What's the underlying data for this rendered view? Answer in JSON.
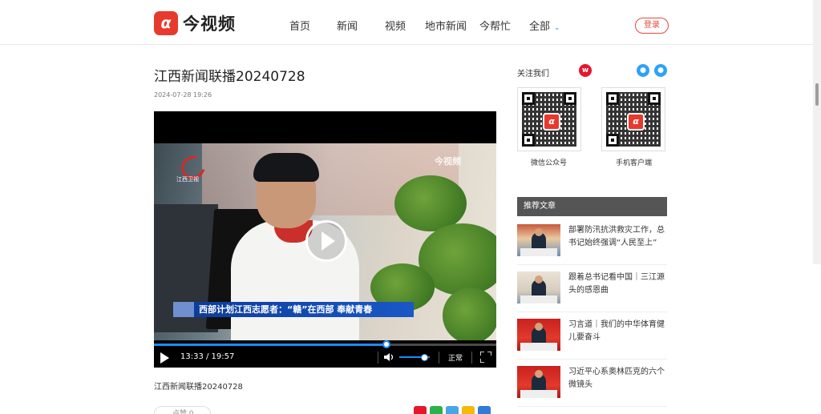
{
  "header": {
    "logo_text": "今视频",
    "logo_mark": "α",
    "nav": [
      "首页",
      "新闻",
      "视频",
      "地市新闻",
      "今帮忙",
      "全部"
    ],
    "nav_more_icon": "chevron-down-icon",
    "login_label": "登录"
  },
  "article": {
    "title": "江西新闻联播20240728",
    "date": "2024-07-28 19:26",
    "description": "江西新闻联播20240728",
    "like_label": "点赞 0"
  },
  "video": {
    "watermark": "今视频",
    "channel_logo_text": "江西卫视",
    "caption": "西部计划江西志愿者：“赣”在西部  奉献青春",
    "current_time": "13:33",
    "duration": "19:57",
    "time_text": "13:33 / 19:57",
    "progress": 0.679,
    "volume": 0.8,
    "speed_label": "正常"
  },
  "sidebar": {
    "follow_label": "关注我们",
    "qr_codes": [
      {
        "caption": "微信公众号"
      },
      {
        "caption": "手机客户端"
      }
    ],
    "recommend_title": "推荐文章",
    "recommended": [
      {
        "title": "部署防汛抗洪救灾工作，总书记始终强调“人民至上”"
      },
      {
        "title": "跟着总书记看中国｜三江源头的感恩曲"
      },
      {
        "title": "习言道｜我们的中华体育健儿要奋斗"
      },
      {
        "title": "习近平心系奥林匹克的六个微镜头"
      }
    ]
  },
  "colors": {
    "brand_red": "#e8392e",
    "accent_blue": "#1a8cff",
    "caption_blue": "#1a58c7",
    "sidebar_header": "#555555"
  }
}
